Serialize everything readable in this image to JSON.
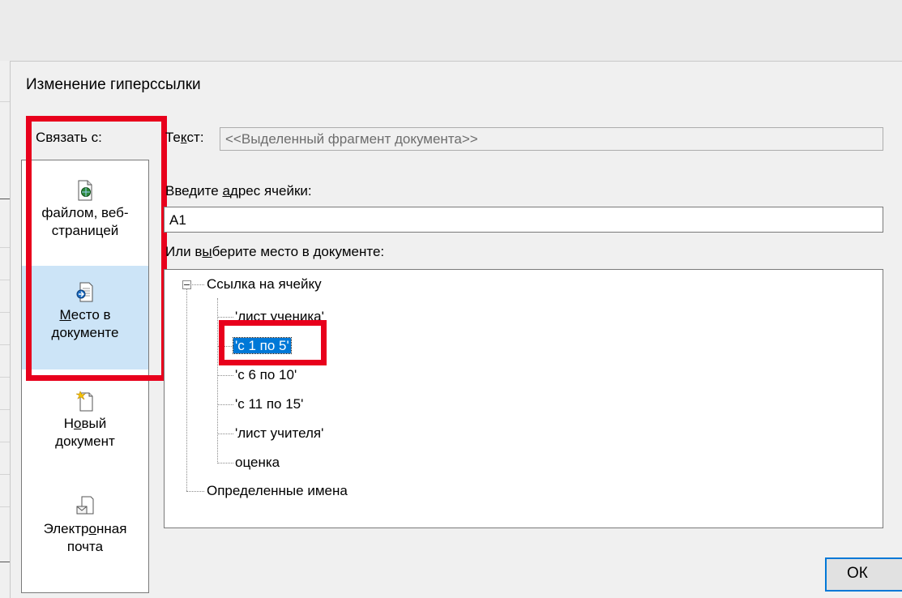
{
  "dialog": {
    "title": "Изменение гиперссылки",
    "link_with_label": "Связать с:"
  },
  "sidebar": {
    "items": [
      {
        "line1": "файлом, веб-",
        "line2": "страницей",
        "icon": "web-page-icon",
        "selected": false
      },
      {
        "line1": "Место в",
        "line2": "документе",
        "icon": "place-in-document-icon",
        "selected": true
      },
      {
        "line1": "Новый",
        "line2": "документ",
        "icon": "new-document-icon",
        "selected": false
      },
      {
        "line1": "Электронная",
        "line2": "почта",
        "icon": "email-icon",
        "selected": false
      }
    ]
  },
  "form": {
    "text_label": "Текст:",
    "text_value": "<<Выделенный фрагмент документа>>",
    "cell_address_label": "Введите адрес ячейки:",
    "cell_address_value": "A1",
    "place_label": "Или выберите место в документе:"
  },
  "tree": {
    "root": "Ссылка на ячейку",
    "children": [
      "'лист ученика'",
      "'с 1 по 5'",
      "'с 6 по 10'",
      "'с 11 по 15'",
      "'лист учителя'",
      "оценка"
    ],
    "selected": "'с 1 по 5'",
    "defined_names": "Определенные имена"
  },
  "buttons": {
    "ok": "ОК"
  },
  "colors": {
    "selection": "#0078d7",
    "highlight_box": "#e8001c",
    "selected_item_bg": "#cce4f7"
  }
}
